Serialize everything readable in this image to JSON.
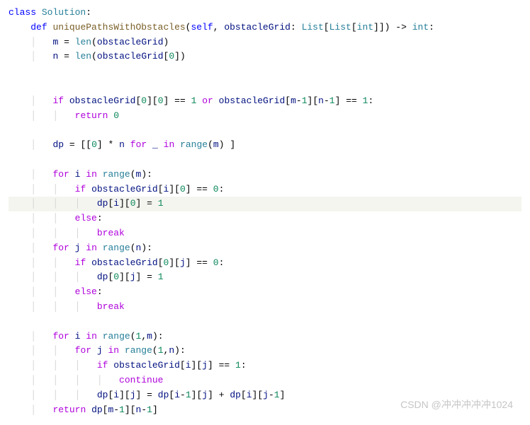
{
  "watermark": "CSDN @冲冲冲冲冲1024",
  "tokens": {
    "class": "class",
    "def": "def",
    "if": "if",
    "or": "or",
    "return": "return",
    "for": "for",
    "in": "in",
    "else": "else",
    "break": "break",
    "continue": "continue",
    "Solution": "Solution",
    "uniquePathsWithObstacles": "uniquePathsWithObstacles",
    "self": "self",
    "obstacleGrid": "obstacleGrid",
    "List": "List",
    "int": "int",
    "m": "m",
    "n": "n",
    "len": "len",
    "dp": "dp",
    "i": "i",
    "j": "j",
    "range": "range",
    "underscore": "_",
    "zero": "0",
    "one": "1",
    "colon": ":",
    "arrow": "->",
    "eq": "=",
    "eqeq": "==",
    "plus": "+",
    "minus": "-",
    "star": "*",
    "lparen": "(",
    "rparen": ")",
    "lbracket": "[",
    "rbracket": "]",
    "comma": ","
  }
}
